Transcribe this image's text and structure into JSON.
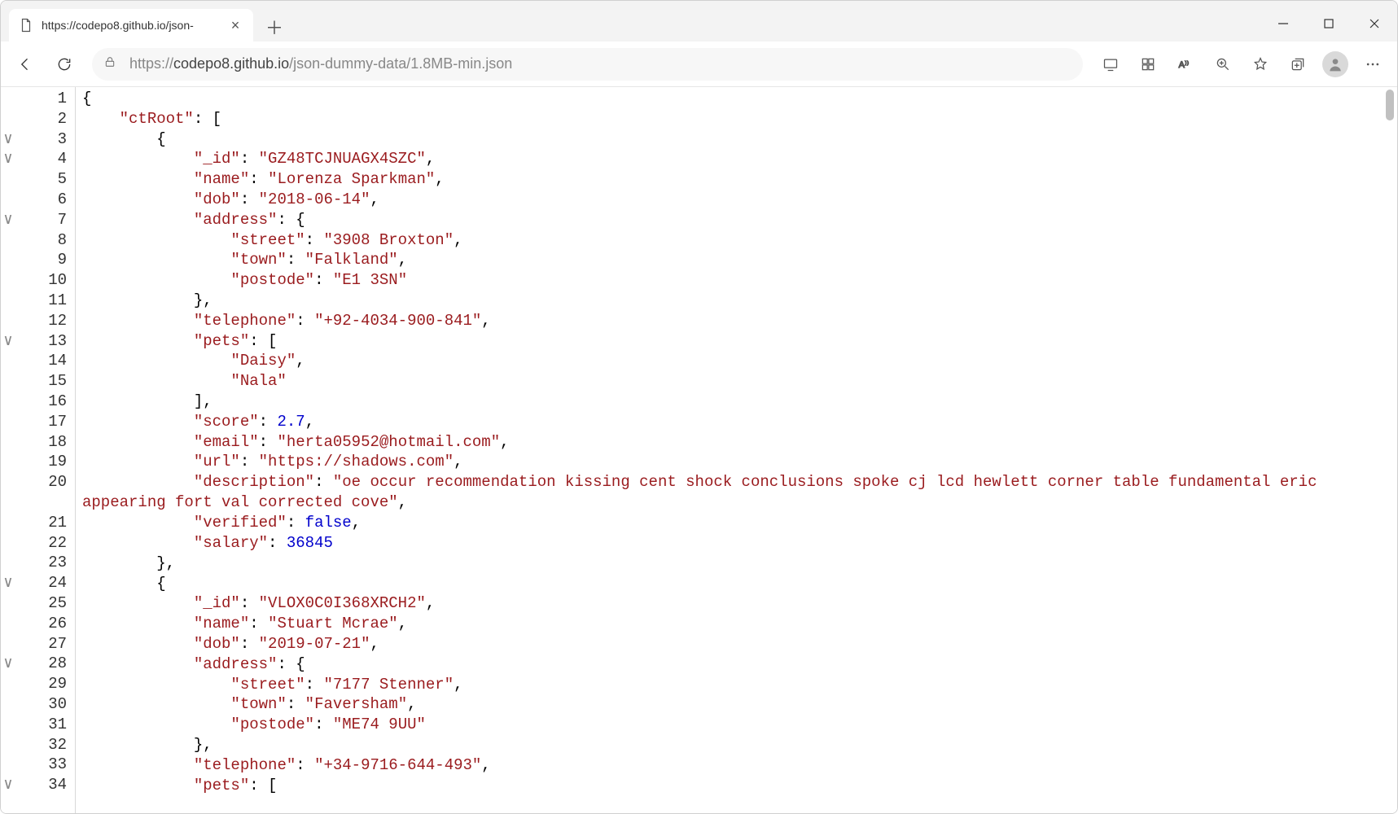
{
  "tab": {
    "title": "https://codepo8.github.io/json-"
  },
  "url": {
    "scheme": "https://",
    "host": "codepo8.github.io",
    "path": "/json-dummy-data/1.8MB-min.json"
  },
  "fold_rows": [
    3,
    4,
    7,
    13,
    24,
    28,
    34
  ],
  "code": [
    {
      "ln": 1,
      "tokens": [
        {
          "t": "{",
          "c": "p"
        }
      ]
    },
    {
      "ln": 2,
      "indent": 4,
      "tokens": [
        {
          "t": "\"ctRoot\"",
          "c": "k"
        },
        {
          "t": ": [",
          "c": "p"
        }
      ]
    },
    {
      "ln": 3,
      "indent": 8,
      "tokens": [
        {
          "t": "{",
          "c": "p"
        }
      ]
    },
    {
      "ln": 4,
      "indent": 12,
      "tokens": [
        {
          "t": "\"_id\"",
          "c": "k"
        },
        {
          "t": ": ",
          "c": "p"
        },
        {
          "t": "\"GZ48TCJNUAGX4SZC\"",
          "c": "k"
        },
        {
          "t": ",",
          "c": "p"
        }
      ]
    },
    {
      "ln": 5,
      "indent": 12,
      "tokens": [
        {
          "t": "\"name\"",
          "c": "k"
        },
        {
          "t": ": ",
          "c": "p"
        },
        {
          "t": "\"Lorenza Sparkman\"",
          "c": "k"
        },
        {
          "t": ",",
          "c": "p"
        }
      ]
    },
    {
      "ln": 6,
      "indent": 12,
      "tokens": [
        {
          "t": "\"dob\"",
          "c": "k"
        },
        {
          "t": ": ",
          "c": "p"
        },
        {
          "t": "\"2018-06-14\"",
          "c": "k"
        },
        {
          "t": ",",
          "c": "p"
        }
      ]
    },
    {
      "ln": 7,
      "indent": 12,
      "tokens": [
        {
          "t": "\"address\"",
          "c": "k"
        },
        {
          "t": ": {",
          "c": "p"
        }
      ]
    },
    {
      "ln": 8,
      "indent": 16,
      "tokens": [
        {
          "t": "\"street\"",
          "c": "k"
        },
        {
          "t": ": ",
          "c": "p"
        },
        {
          "t": "\"3908 Broxton\"",
          "c": "k"
        },
        {
          "t": ",",
          "c": "p"
        }
      ]
    },
    {
      "ln": 9,
      "indent": 16,
      "tokens": [
        {
          "t": "\"town\"",
          "c": "k"
        },
        {
          "t": ": ",
          "c": "p"
        },
        {
          "t": "\"Falkland\"",
          "c": "k"
        },
        {
          "t": ",",
          "c": "p"
        }
      ]
    },
    {
      "ln": 10,
      "indent": 16,
      "tokens": [
        {
          "t": "\"postode\"",
          "c": "k"
        },
        {
          "t": ": ",
          "c": "p"
        },
        {
          "t": "\"E1 3SN\"",
          "c": "k"
        }
      ]
    },
    {
      "ln": 11,
      "indent": 12,
      "tokens": [
        {
          "t": "},",
          "c": "p"
        }
      ]
    },
    {
      "ln": 12,
      "indent": 12,
      "tokens": [
        {
          "t": "\"telephone\"",
          "c": "k"
        },
        {
          "t": ": ",
          "c": "p"
        },
        {
          "t": "\"+92-4034-900-841\"",
          "c": "k"
        },
        {
          "t": ",",
          "c": "p"
        }
      ]
    },
    {
      "ln": 13,
      "indent": 12,
      "tokens": [
        {
          "t": "\"pets\"",
          "c": "k"
        },
        {
          "t": ": [",
          "c": "p"
        }
      ]
    },
    {
      "ln": 14,
      "indent": 16,
      "tokens": [
        {
          "t": "\"Daisy\"",
          "c": "k"
        },
        {
          "t": ",",
          "c": "p"
        }
      ]
    },
    {
      "ln": 15,
      "indent": 16,
      "tokens": [
        {
          "t": "\"Nala\"",
          "c": "k"
        }
      ]
    },
    {
      "ln": 16,
      "indent": 12,
      "tokens": [
        {
          "t": "],",
          "c": "p"
        }
      ]
    },
    {
      "ln": 17,
      "indent": 12,
      "tokens": [
        {
          "t": "\"score\"",
          "c": "k"
        },
        {
          "t": ": ",
          "c": "p"
        },
        {
          "t": "2.7",
          "c": "n"
        },
        {
          "t": ",",
          "c": "p"
        }
      ]
    },
    {
      "ln": 18,
      "indent": 12,
      "tokens": [
        {
          "t": "\"email\"",
          "c": "k"
        },
        {
          "t": ": ",
          "c": "p"
        },
        {
          "t": "\"herta05952@hotmail.com\"",
          "c": "k"
        },
        {
          "t": ",",
          "c": "p"
        }
      ]
    },
    {
      "ln": 19,
      "indent": 12,
      "tokens": [
        {
          "t": "\"url\"",
          "c": "k"
        },
        {
          "t": ": ",
          "c": "p"
        },
        {
          "t": "\"https://shadows.com\"",
          "c": "k"
        },
        {
          "t": ",",
          "c": "p"
        }
      ]
    },
    {
      "ln": 20,
      "indent": 12,
      "wrap": true,
      "tokens": [
        {
          "t": "\"description\"",
          "c": "k"
        },
        {
          "t": ": ",
          "c": "p"
        },
        {
          "t": "\"oe occur recommendation kissing cent shock conclusions spoke cj lcd hewlett corner table fundamental eric appearing fort val corrected cove\"",
          "c": "k"
        },
        {
          "t": ",",
          "c": "p"
        }
      ]
    },
    {
      "ln": 21,
      "indent": 12,
      "tokens": [
        {
          "t": "\"verified\"",
          "c": "k"
        },
        {
          "t": ": ",
          "c": "p"
        },
        {
          "t": "false",
          "c": "n"
        },
        {
          "t": ",",
          "c": "p"
        }
      ]
    },
    {
      "ln": 22,
      "indent": 12,
      "tokens": [
        {
          "t": "\"salary\"",
          "c": "k"
        },
        {
          "t": ": ",
          "c": "p"
        },
        {
          "t": "36845",
          "c": "n"
        }
      ]
    },
    {
      "ln": 23,
      "indent": 8,
      "tokens": [
        {
          "t": "},",
          "c": "p"
        }
      ]
    },
    {
      "ln": 24,
      "indent": 8,
      "tokens": [
        {
          "t": "{",
          "c": "p"
        }
      ]
    },
    {
      "ln": 25,
      "indent": 12,
      "tokens": [
        {
          "t": "\"_id\"",
          "c": "k"
        },
        {
          "t": ": ",
          "c": "p"
        },
        {
          "t": "\"VLOX0C0I368XRCH2\"",
          "c": "k"
        },
        {
          "t": ",",
          "c": "p"
        }
      ]
    },
    {
      "ln": 26,
      "indent": 12,
      "tokens": [
        {
          "t": "\"name\"",
          "c": "k"
        },
        {
          "t": ": ",
          "c": "p"
        },
        {
          "t": "\"Stuart Mcrae\"",
          "c": "k"
        },
        {
          "t": ",",
          "c": "p"
        }
      ]
    },
    {
      "ln": 27,
      "indent": 12,
      "tokens": [
        {
          "t": "\"dob\"",
          "c": "k"
        },
        {
          "t": ": ",
          "c": "p"
        },
        {
          "t": "\"2019-07-21\"",
          "c": "k"
        },
        {
          "t": ",",
          "c": "p"
        }
      ]
    },
    {
      "ln": 28,
      "indent": 12,
      "tokens": [
        {
          "t": "\"address\"",
          "c": "k"
        },
        {
          "t": ": {",
          "c": "p"
        }
      ]
    },
    {
      "ln": 29,
      "indent": 16,
      "tokens": [
        {
          "t": "\"street\"",
          "c": "k"
        },
        {
          "t": ": ",
          "c": "p"
        },
        {
          "t": "\"7177 Stenner\"",
          "c": "k"
        },
        {
          "t": ",",
          "c": "p"
        }
      ]
    },
    {
      "ln": 30,
      "indent": 16,
      "tokens": [
        {
          "t": "\"town\"",
          "c": "k"
        },
        {
          "t": ": ",
          "c": "p"
        },
        {
          "t": "\"Faversham\"",
          "c": "k"
        },
        {
          "t": ",",
          "c": "p"
        }
      ]
    },
    {
      "ln": 31,
      "indent": 16,
      "tokens": [
        {
          "t": "\"postode\"",
          "c": "k"
        },
        {
          "t": ": ",
          "c": "p"
        },
        {
          "t": "\"ME74 9UU\"",
          "c": "k"
        }
      ]
    },
    {
      "ln": 32,
      "indent": 12,
      "tokens": [
        {
          "t": "},",
          "c": "p"
        }
      ]
    },
    {
      "ln": 33,
      "indent": 12,
      "tokens": [
        {
          "t": "\"telephone\"",
          "c": "k"
        },
        {
          "t": ": ",
          "c": "p"
        },
        {
          "t": "\"+34-9716-644-493\"",
          "c": "k"
        },
        {
          "t": ",",
          "c": "p"
        }
      ]
    },
    {
      "ln": 34,
      "indent": 12,
      "tokens": [
        {
          "t": "\"pets\"",
          "c": "k"
        },
        {
          "t": ": [",
          "c": "p"
        }
      ]
    }
  ]
}
